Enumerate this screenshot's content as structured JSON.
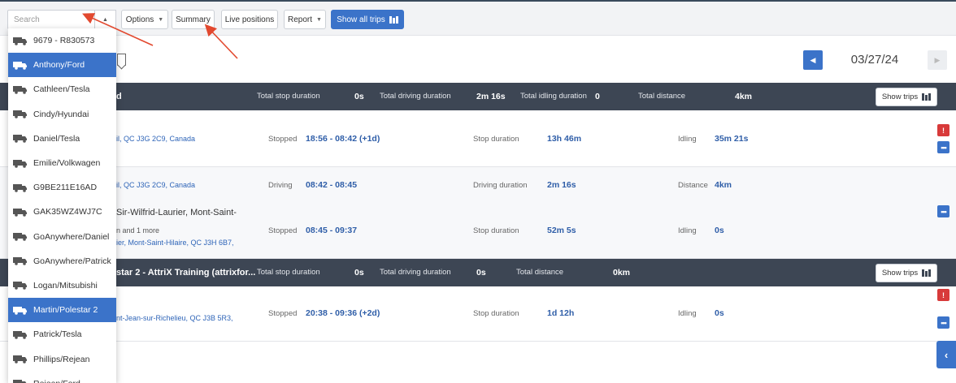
{
  "toolbar": {
    "search_placeholder": "Search",
    "options": "Options",
    "summary": "Summary",
    "live_positions": "Live positions",
    "report": "Report",
    "show_all_trips": "Show all trips"
  },
  "datebar": {
    "date": "03/27/24"
  },
  "vehicles": [
    "9679 - R830573",
    "Anthony/Ford",
    "Cathleen/Tesla",
    "Cindy/Hyundai",
    "Daniel/Tesla",
    "Emilie/Volkwagen",
    "G9BE211E16AD",
    "GAK35WZ4WJ7C",
    "GoAnywhere/Daniel",
    "GoAnywhere/Patrick",
    "Logan/Mitsubishi",
    "Martin/Polestar 2",
    "Patrick/Tesla",
    "Phillips/Rejean",
    "Rejean/Ford"
  ],
  "selected_vehicles": [
    "Anthony/Ford",
    "Martin/Polestar 2"
  ],
  "group1": {
    "vehicle": "d",
    "stop_label": "Total stop duration",
    "stop_val": "0s",
    "driving_label": "Total driving duration",
    "driving_val": "2m 16s",
    "idling_label": "Total idling duration",
    "idling_val": "0",
    "distance_label": "Total distance",
    "distance_val": "4km",
    "show_trips": "Show trips",
    "rows": [
      {
        "addr_link": "il, QC J3G 2C9, Canada",
        "state": "Stopped",
        "time": "18:56 - 08:42 (+1d)",
        "dur_label": "Stop duration",
        "dur": "13h 46m",
        "extra_label": "Idling",
        "extra": "35m 21s"
      },
      {
        "addr_link": "il, QC J3G 2C9, Canada",
        "state": "Driving",
        "time": "08:42 - 08:45",
        "dur_label": "Driving duration",
        "dur": "2m 16s",
        "extra_label": "Distance",
        "extra": "4km"
      },
      {
        "addr": "Sir-Wilfrid-Laurier, Mont-Saint-",
        "sub": "n and 1 more",
        "addr_link": "ier, Mont-Saint-Hilaire, QC J3H 6B7,",
        "state": "Stopped",
        "time": "08:45 - 09:37",
        "dur_label": "Stop duration",
        "dur": "52m 5s",
        "extra_label": "Idling",
        "extra": "0s"
      }
    ]
  },
  "group2": {
    "vehicle": "star 2 - AttriX Training (attrixfor...",
    "stop_label": "Total stop duration",
    "stop_val": "0s",
    "driving_label": "Total driving duration",
    "driving_val": "0s",
    "distance_label": "Total distance",
    "distance_val": "0km",
    "show_trips": "Show trips",
    "rows": [
      {
        "addr_link": "nt-Jean-sur-Richelieu, QC J3B 5R3,",
        "state": "Stopped",
        "time": "20:38 - 09:36 (+2d)",
        "dur_label": "Stop duration",
        "dur": "1d 12h",
        "extra_label": "Idling",
        "extra": "0s"
      }
    ]
  },
  "icons": {
    "truck": "truck-icon",
    "map": "map-icon",
    "warning": "warning-icon",
    "more": "more-icon",
    "bookmark": "bookmark-icon",
    "prev": "chevron-left-icon",
    "next": "chevron-right-icon",
    "panel": "panel-toggle-icon"
  },
  "colors": {
    "accent": "#3b73c9",
    "header_dark": "#3d4654",
    "warning": "#d83a3a",
    "annotation_arrow": "#e2492f"
  }
}
